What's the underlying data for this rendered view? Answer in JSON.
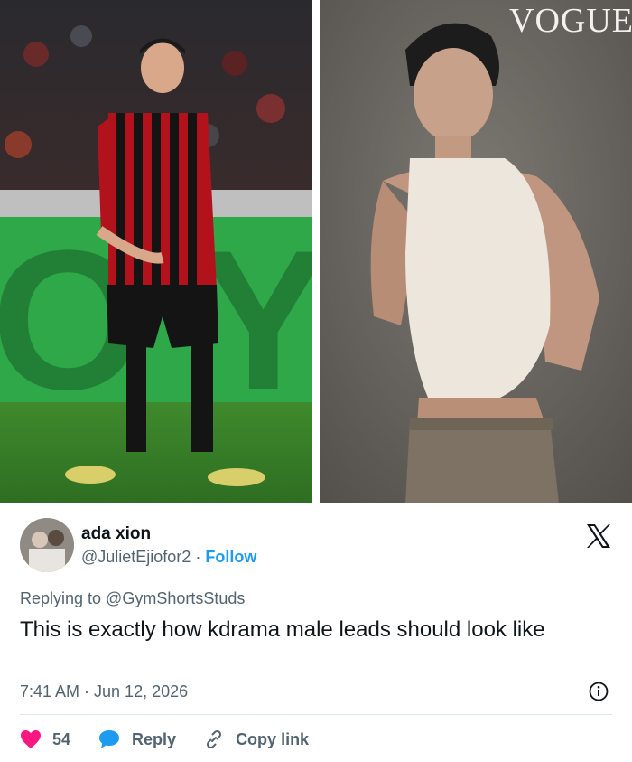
{
  "photos": {
    "watermark": "VOGUE",
    "left": {
      "kind": "photo",
      "subject": "soccer player"
    },
    "right": {
      "kind": "photo",
      "subject": "magazine portrait"
    }
  },
  "tweet": {
    "display_name": "ada xion",
    "handle": "@JulietEjiofor2",
    "separator": "·",
    "follow_label": "Follow",
    "replying_to": "Replying to @GymShortsStuds",
    "text": "This is exactly how kdrama male leads should look like",
    "timestamp": "7:41 AM · Jun 12, 2026",
    "like_count": "54",
    "reply_label": "Reply",
    "copy_link_label": "Copy link"
  },
  "colors": {
    "link": "#1d9bf0",
    "heart": "#f91880",
    "muted": "#536471",
    "text": "#0f1419"
  },
  "icons": [
    "x-logo-icon",
    "info-icon",
    "heart-icon",
    "reply-bubble-icon",
    "link-icon"
  ]
}
